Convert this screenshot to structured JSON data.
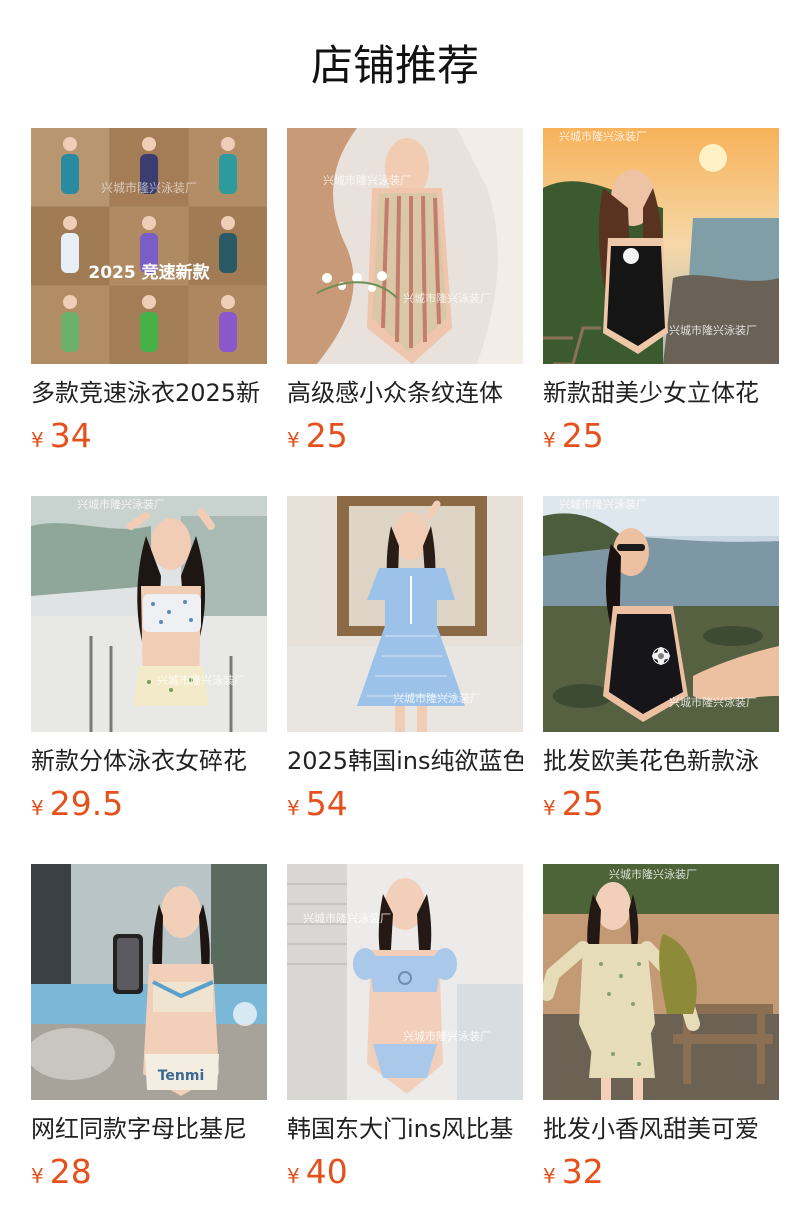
{
  "section": {
    "title": "店铺推荐"
  },
  "currency_symbol": "¥",
  "watermark": "兴城市隆兴泳装厂",
  "products": [
    {
      "name": "多款竞速泳衣2025新",
      "price": "34",
      "image_text": "2025 竞速新款"
    },
    {
      "name": "高级感小众条纹连体",
      "price": "25"
    },
    {
      "name": "新款甜美少女立体花",
      "price": "25"
    },
    {
      "name": "新款分体泳衣女碎花",
      "price": "29.5"
    },
    {
      "name": "2025韩国ins纯欲蓝色",
      "price": "54"
    },
    {
      "name": "批发欧美花色新款泳",
      "price": "25"
    },
    {
      "name": "网红同款字母比基尼",
      "price": "28"
    },
    {
      "name": "韩国东大门ins风比基",
      "price": "40"
    },
    {
      "name": "批发小香风甜美可爱",
      "price": "32"
    }
  ],
  "colors": {
    "price": "#e5511d",
    "title": "#111111",
    "name": "#222222"
  }
}
